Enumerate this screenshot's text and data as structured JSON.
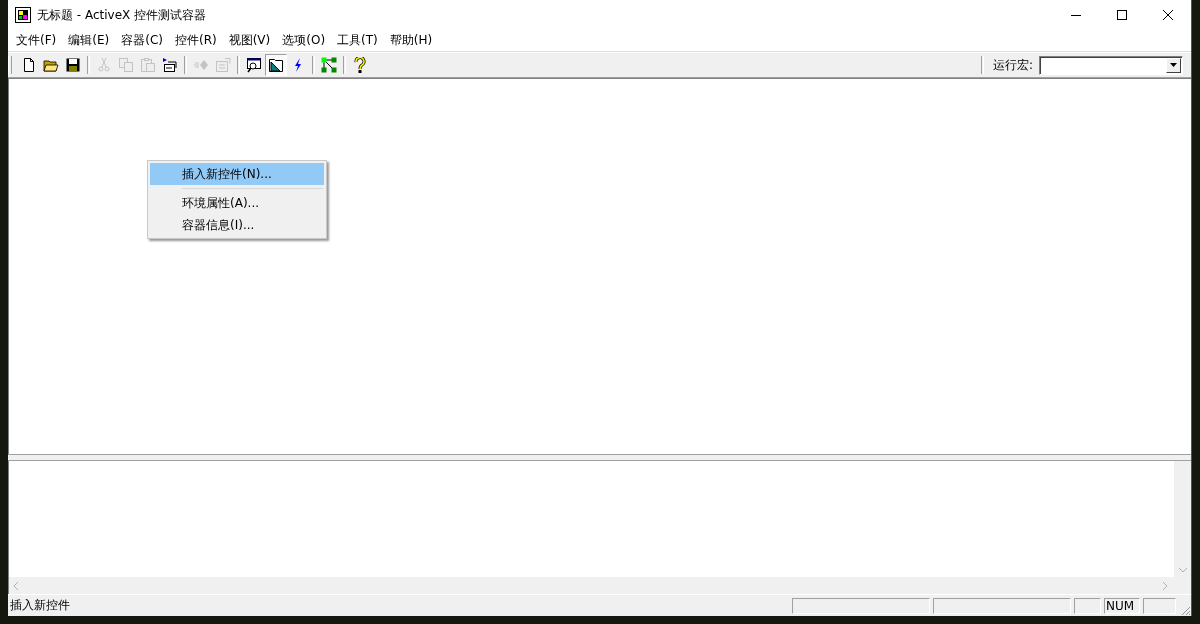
{
  "window": {
    "title": "无标题 - ActiveX 控件测试容器"
  },
  "menu": [
    "文件(F)",
    "编辑(E)",
    "容器(C)",
    "控件(R)",
    "视图(V)",
    "选项(O)",
    "工具(T)",
    "帮助(H)"
  ],
  "toolbar": {
    "groups": [
      [
        {
          "kind": "new",
          "disabled": false,
          "pressed": false
        },
        {
          "kind": "open",
          "disabled": false,
          "pressed": false
        },
        {
          "kind": "save",
          "disabled": false,
          "pressed": false
        }
      ],
      [
        {
          "kind": "cut",
          "disabled": true,
          "pressed": false
        },
        {
          "kind": "copy",
          "disabled": true,
          "pressed": false
        },
        {
          "kind": "paste",
          "disabled": true,
          "pressed": false
        },
        {
          "kind": "insert",
          "disabled": false,
          "pressed": false
        }
      ],
      [
        {
          "kind": "invoke",
          "disabled": true,
          "pressed": false
        },
        {
          "kind": "properties",
          "disabled": true,
          "pressed": false
        }
      ],
      [
        {
          "kind": "preview",
          "disabled": false,
          "pressed": false
        },
        {
          "kind": "design",
          "disabled": false,
          "pressed": true
        },
        {
          "kind": "events",
          "disabled": false,
          "pressed": false
        }
      ],
      [
        {
          "kind": "network",
          "disabled": false,
          "pressed": false
        }
      ],
      [
        {
          "kind": "help",
          "disabled": false,
          "pressed": false
        }
      ]
    ],
    "macro_label": "运行宏:"
  },
  "context_menu": [
    {
      "kind": "item",
      "label": "插入新控件(N)...",
      "selected": true
    },
    {
      "kind": "separator"
    },
    {
      "kind": "item",
      "label": "环境属性(A)...",
      "selected": false
    },
    {
      "kind": "item",
      "label": "容器信息(I)...",
      "selected": false
    }
  ],
  "status_bar": {
    "message": "插入新控件",
    "indicator": "NUM"
  }
}
